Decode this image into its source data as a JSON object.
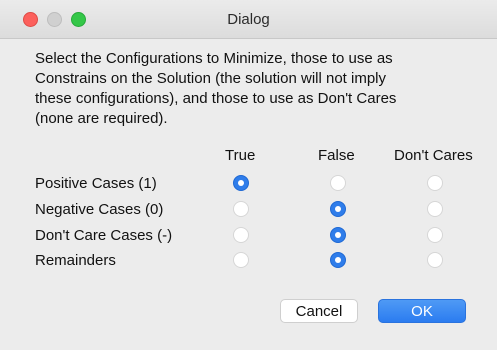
{
  "window": {
    "title": "Dialog"
  },
  "instructions": [
    "Select the Configurations to Minimize, those to use as",
    "Constrains on the Solution (the solution will not imply",
    "these configurations), and those to use as Don't Cares",
    "(none are required)."
  ],
  "columns": [
    "True",
    "False",
    "Don't Cares"
  ],
  "rows": [
    {
      "label": "Positive Cases (1)",
      "selected": "True"
    },
    {
      "label": "Negative Cases (0)",
      "selected": "False"
    },
    {
      "label": "Don't Care Cases (-)",
      "selected": "False"
    },
    {
      "label": "Remainders",
      "selected": "False"
    }
  ],
  "buttons": {
    "cancel": "Cancel",
    "ok": "OK"
  },
  "colors": {
    "accent": "#2f7dea",
    "close": "#fc605c",
    "maximize": "#34c748"
  }
}
